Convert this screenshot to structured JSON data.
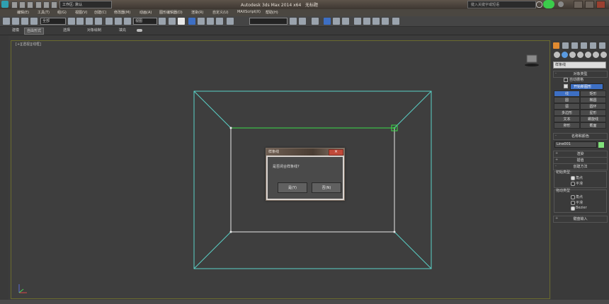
{
  "titlebar": {
    "app_title": "Autodesk 3ds Max 2014 x64",
    "doc_title": "无标题",
    "workspace_label": "工作区: 默认",
    "search_placeholder": "键入关键字或短语",
    "user_color": "#3bcc4b"
  },
  "menubar": {
    "items": [
      "编辑(E)",
      "工具(T)",
      "组(G)",
      "视图(V)",
      "创建(C)",
      "修改器(M)",
      "动画(A)",
      "图形编辑器(D)",
      "渲染(R)",
      "自定义(U)",
      "MAXScript(X)",
      "帮助(H)"
    ]
  },
  "toolbar": {
    "selection_filter": "全部",
    "view_select": "视图",
    "named_selection": ""
  },
  "ribbon": {
    "tabs": [
      "建模",
      "自由形式",
      "选择",
      "对象绘制",
      "填充"
    ],
    "active": "自由形式"
  },
  "viewport": {
    "label": "[+][透视][线框]",
    "accent": "#5ad2c8"
  },
  "dialog": {
    "title": "样条线",
    "message": "是否闭合样条线?",
    "yes_label": "是(Y)",
    "no_label": "否(N)"
  },
  "command_panel": {
    "category": "样条线",
    "object_type_header": "对象类型",
    "auto_grid": "自动栅格",
    "start_new_shape": "开始新图形",
    "objects": [
      "线",
      "矩形",
      "圆",
      "椭圆",
      "弧",
      "圆环",
      "多边形",
      "星形",
      "文本",
      "螺旋线",
      "卵形",
      "截面"
    ],
    "selected_object": "线",
    "name_color_header": "名称和颜色",
    "object_name": "Line001",
    "swatch_color": "#80e07a",
    "rendering_header": "渲染",
    "interpolation_header": "插值",
    "creation_method_header": "创建方法",
    "initial_type_label": "初始类型",
    "initial_options": [
      "角点",
      "平滑"
    ],
    "initial_selected": "角点",
    "drag_type_label": "拖动类型",
    "drag_options": [
      "角点",
      "平滑",
      "Bezier"
    ],
    "drag_selected": "Bezier",
    "keyboard_entry_header": "键盘输入"
  }
}
